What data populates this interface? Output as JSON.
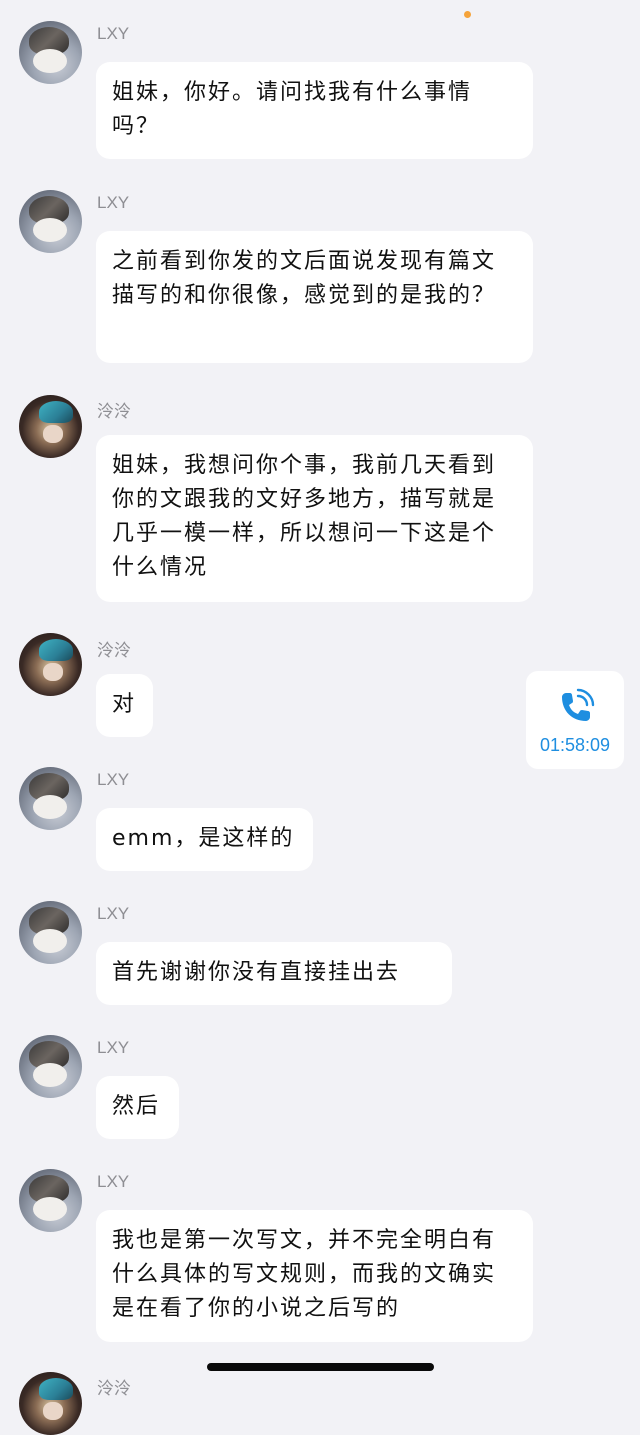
{
  "status": {
    "dot_color": "#f5a33a"
  },
  "messages": [
    {
      "sender": "LXY",
      "avatar": "cat-avatar",
      "text": "姐妹，你好。请问找我有什么事情吗？"
    },
    {
      "sender": "LXY",
      "avatar": "cat-avatar",
      "text": "之前看到你发的文后面说发现有篇文描写的和你很像，感觉到的是我的？"
    },
    {
      "sender": "泠泠",
      "avatar": "anime-avatar",
      "text": "姐妹，我想问你个事，我前几天看到你的文跟我的文好多地方，描写就是几乎一模一样，所以想问一下这是个什么情况"
    },
    {
      "sender": "泠泠",
      "avatar": "anime-avatar",
      "text": "对"
    },
    {
      "sender": "LXY",
      "avatar": "cat-avatar",
      "text": "emm，是这样的"
    },
    {
      "sender": "LXY",
      "avatar": "cat-avatar",
      "text": "首先谢谢你没有直接挂出去"
    },
    {
      "sender": "LXY",
      "avatar": "cat-avatar",
      "text": "然后"
    },
    {
      "sender": "LXY",
      "avatar": "cat-avatar",
      "text": "我也是第一次写文，并不完全明白有什么具体的写文规则，而我的文确实是在看了你的小说之后写的"
    },
    {
      "sender": "泠泠",
      "avatar": "anime-avatar",
      "text": ""
    }
  ],
  "call": {
    "icon": "phone-call-icon",
    "duration": "01:58:09",
    "color": "#1e8ee0"
  },
  "colors": {
    "background": "#f2f2f6",
    "bubble": "#ffffff",
    "name": "#8e8e93"
  }
}
